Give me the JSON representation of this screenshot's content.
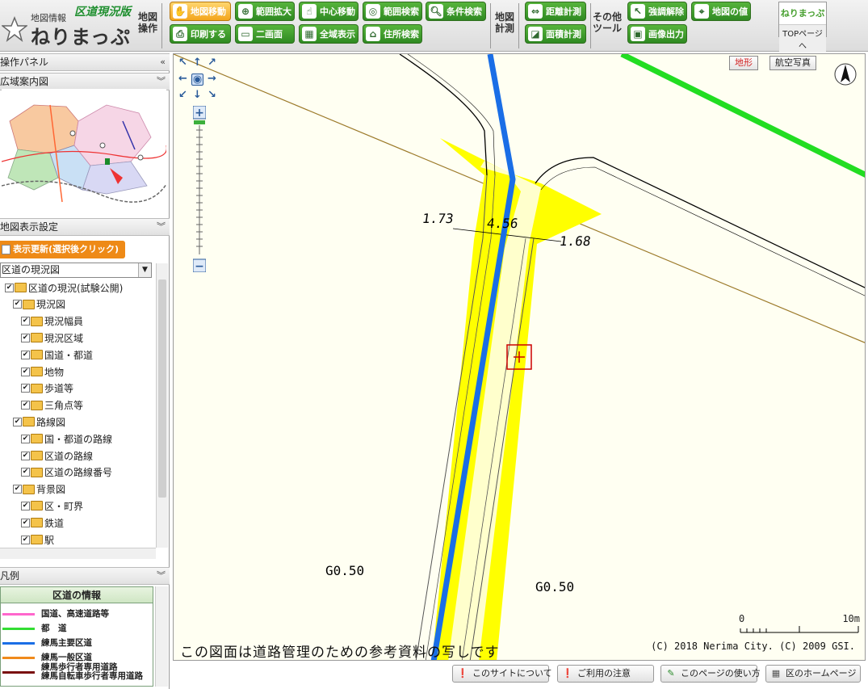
{
  "header": {
    "logo_small": "地図情報",
    "logo_big": "ねりまっぷ",
    "edition": "区道現況版",
    "group_map_ops": "地図\n操作",
    "group_measure": "地図\n計測",
    "group_other": "その他\nツール",
    "buttons": {
      "pan": "地図移動",
      "zoom_range": "範囲拡大",
      "center": "中心移動",
      "range_search": "範囲検索",
      "cond_search": "条件検索",
      "print": "印刷する",
      "two_screen": "二画面",
      "full_view": "全域表示",
      "address_search": "住所検索",
      "distance": "距離計測",
      "area": "面積計測",
      "clear_highlight": "強調解除",
      "map_value": "地図の値",
      "image_output": "画像出力"
    },
    "top_button_brand": "ねりまっぷ",
    "top_button_link": "TOPページへ"
  },
  "left_panel": {
    "operation_panel": "操作パネル",
    "overview_title": "広域案内図",
    "display_settings": "地図表示設定",
    "refresh_button": "表示更新(選択後クリック)",
    "layer_select": "区道の現況図",
    "tree": [
      {
        "label": "区道の現況(試験公開)",
        "level": 0
      },
      {
        "label": "現況図",
        "level": 1
      },
      {
        "label": "現況幅員",
        "level": 2
      },
      {
        "label": "現況区域",
        "level": 2
      },
      {
        "label": "国道・都道",
        "level": 2
      },
      {
        "label": "地物",
        "level": 2
      },
      {
        "label": "歩道等",
        "level": 2
      },
      {
        "label": "三角点等",
        "level": 2
      },
      {
        "label": "路線図",
        "level": 1
      },
      {
        "label": "国・都道の路線",
        "level": 2
      },
      {
        "label": "区道の路線",
        "level": 2
      },
      {
        "label": "区道の路線番号",
        "level": 2
      },
      {
        "label": "背景図",
        "level": 1
      },
      {
        "label": "区・町界",
        "level": 2
      },
      {
        "label": "鉄道",
        "level": 2
      },
      {
        "label": "駅",
        "level": 2
      }
    ],
    "legend_header": "凡例",
    "legend_title": "区道の情報",
    "legend_items": [
      {
        "label": "国道、高速道路等",
        "color": "#ff66cc"
      },
      {
        "label": "都　道",
        "color": "#33dd33"
      },
      {
        "label": "練馬主要区道",
        "color": "#1a6ee6"
      },
      {
        "label": "練馬一般区道",
        "color": "#f08a1c"
      },
      {
        "label": "練馬歩行者専用道路\n練馬自転車歩行者専用道路",
        "color": "#7a1010"
      }
    ]
  },
  "map": {
    "tab_terrain": "地形",
    "tab_aerial": "航空写真",
    "dim_left": "1.73",
    "dim_center": "4.56",
    "dim_right": "1.68",
    "go_left": "G0.50",
    "go_right": "G0.50",
    "disclaimer": "この図面は道路管理のための参考資料の写しです",
    "copyright": "(C) 2018 Nerima City. (C) 2009 GSI.",
    "scale_start": "0",
    "scale_end": "10m",
    "colors": {
      "road_yellow": "#ffff00",
      "road_light": "#ffffcc",
      "main_route": "#1a6ee6",
      "metro_road": "#22dd22"
    }
  },
  "footer": {
    "about": "このサイトについて",
    "notice": "ご利用の注意",
    "howto": "このページの使い方",
    "homepage": "区のホームページ"
  }
}
